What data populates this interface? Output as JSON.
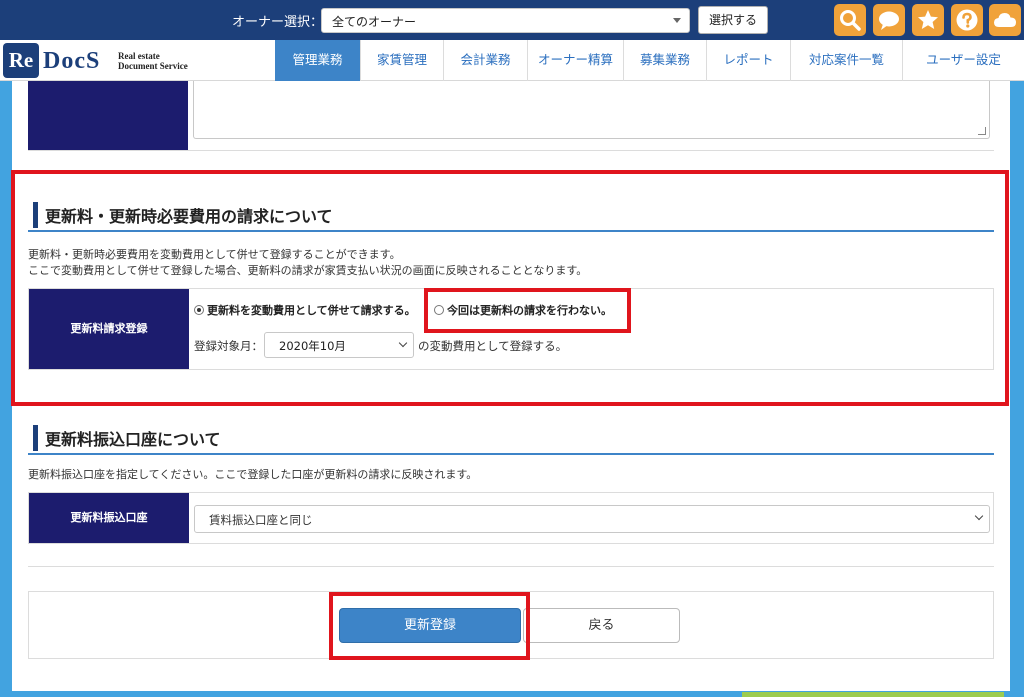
{
  "topbar": {
    "owner_label": "オーナー選択：",
    "owner_select_value": "全てのオーナー",
    "select_button": "選択する",
    "icons": [
      "search-icon",
      "chat-icon",
      "star-icon",
      "help-icon",
      "cloud-icon"
    ]
  },
  "logo": {
    "re": "Re",
    "docs": "DocS",
    "sub_line1": "Real estate",
    "sub_line2": "Document Service"
  },
  "nav": {
    "tabs": [
      {
        "label": "管理業務",
        "active": true
      },
      {
        "label": "家賃管理",
        "active": false
      },
      {
        "label": "会計業務",
        "active": false
      },
      {
        "label": "オーナー精算",
        "active": false
      },
      {
        "label": "募集業務",
        "active": false
      },
      {
        "label": "レポート",
        "active": false
      },
      {
        "label": "対応案件一覧",
        "active": false
      },
      {
        "label": "ユーザー設定",
        "active": false
      }
    ]
  },
  "renewal_fee": {
    "title": "更新料・更新時必要費用の請求について",
    "desc_line1": "更新料・更新時必要費用を変動費用として併せて登録することができます。",
    "desc_line2": "ここで変動費用として併せて登録した場合、更新料の請求が家賃支払い状況の画面に反映されることとなります。",
    "row_label": "更新料請求登録",
    "option_register": "更新料を変動費用として併せて請求する。",
    "option_none": "今回は更新料の請求を行わない。",
    "selected": "register",
    "month_label": "登録対象月：",
    "month_value": "2020年10月",
    "month_suffix": "の変動費用として登録する。"
  },
  "renewal_account": {
    "title": "更新料振込口座について",
    "desc": "更新料振込口座を指定してください。ここで登録した口座が更新料の請求に反映されます。",
    "row_label": "更新料振込口座",
    "select_value": "賃料振込口座と同じ"
  },
  "actions": {
    "submit": "更新登録",
    "back": "戻る"
  },
  "colors": {
    "topbar": "#1c3f7a",
    "accent": "#3d84c8",
    "label_bg": "#1c1c6e",
    "highlight": "#e0151d",
    "icon_bg": "#f0a23a"
  }
}
